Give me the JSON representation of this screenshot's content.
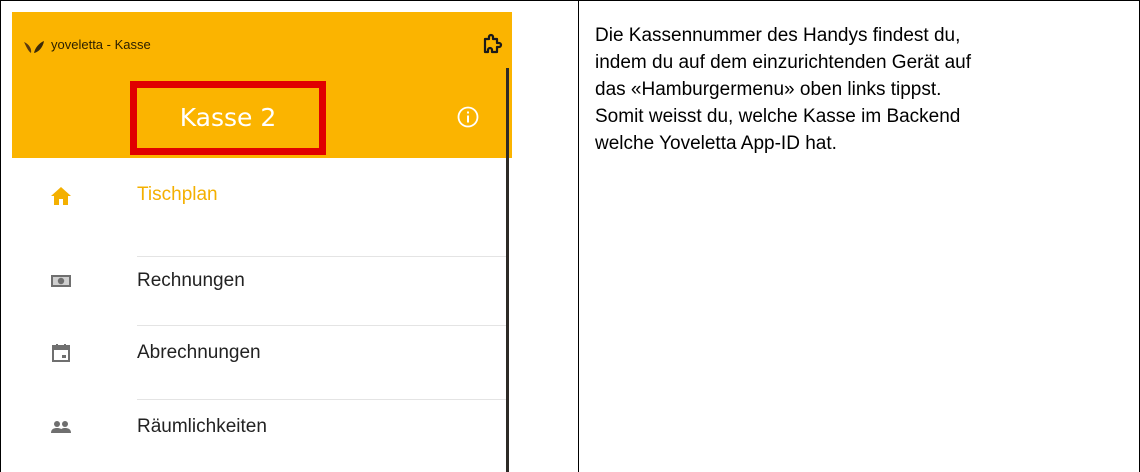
{
  "app": {
    "title": "yoveletta - Kasse",
    "register_name": "Kasse 2",
    "accent_color": "#fbb400",
    "highlight_color": "#e00000",
    "menu": [
      {
        "label": "Tischplan",
        "icon": "home-icon",
        "active": true
      },
      {
        "label": "Rechnungen",
        "icon": "cash-icon",
        "active": false
      },
      {
        "label": "Abrechnungen",
        "icon": "calendar-icon",
        "active": false
      },
      {
        "label": "Räumlichkeiten",
        "icon": "people-icon",
        "active": false
      }
    ]
  },
  "description": {
    "lines": [
      "Die Kassennummer des Handys findest du,",
      "indem du auf dem einzurichtenden Gerät auf",
      "das «Hamburgermenu» oben links tippst.",
      "Somit weisst du, welche Kasse im Backend",
      "welche Yoveletta App-ID hat."
    ]
  }
}
